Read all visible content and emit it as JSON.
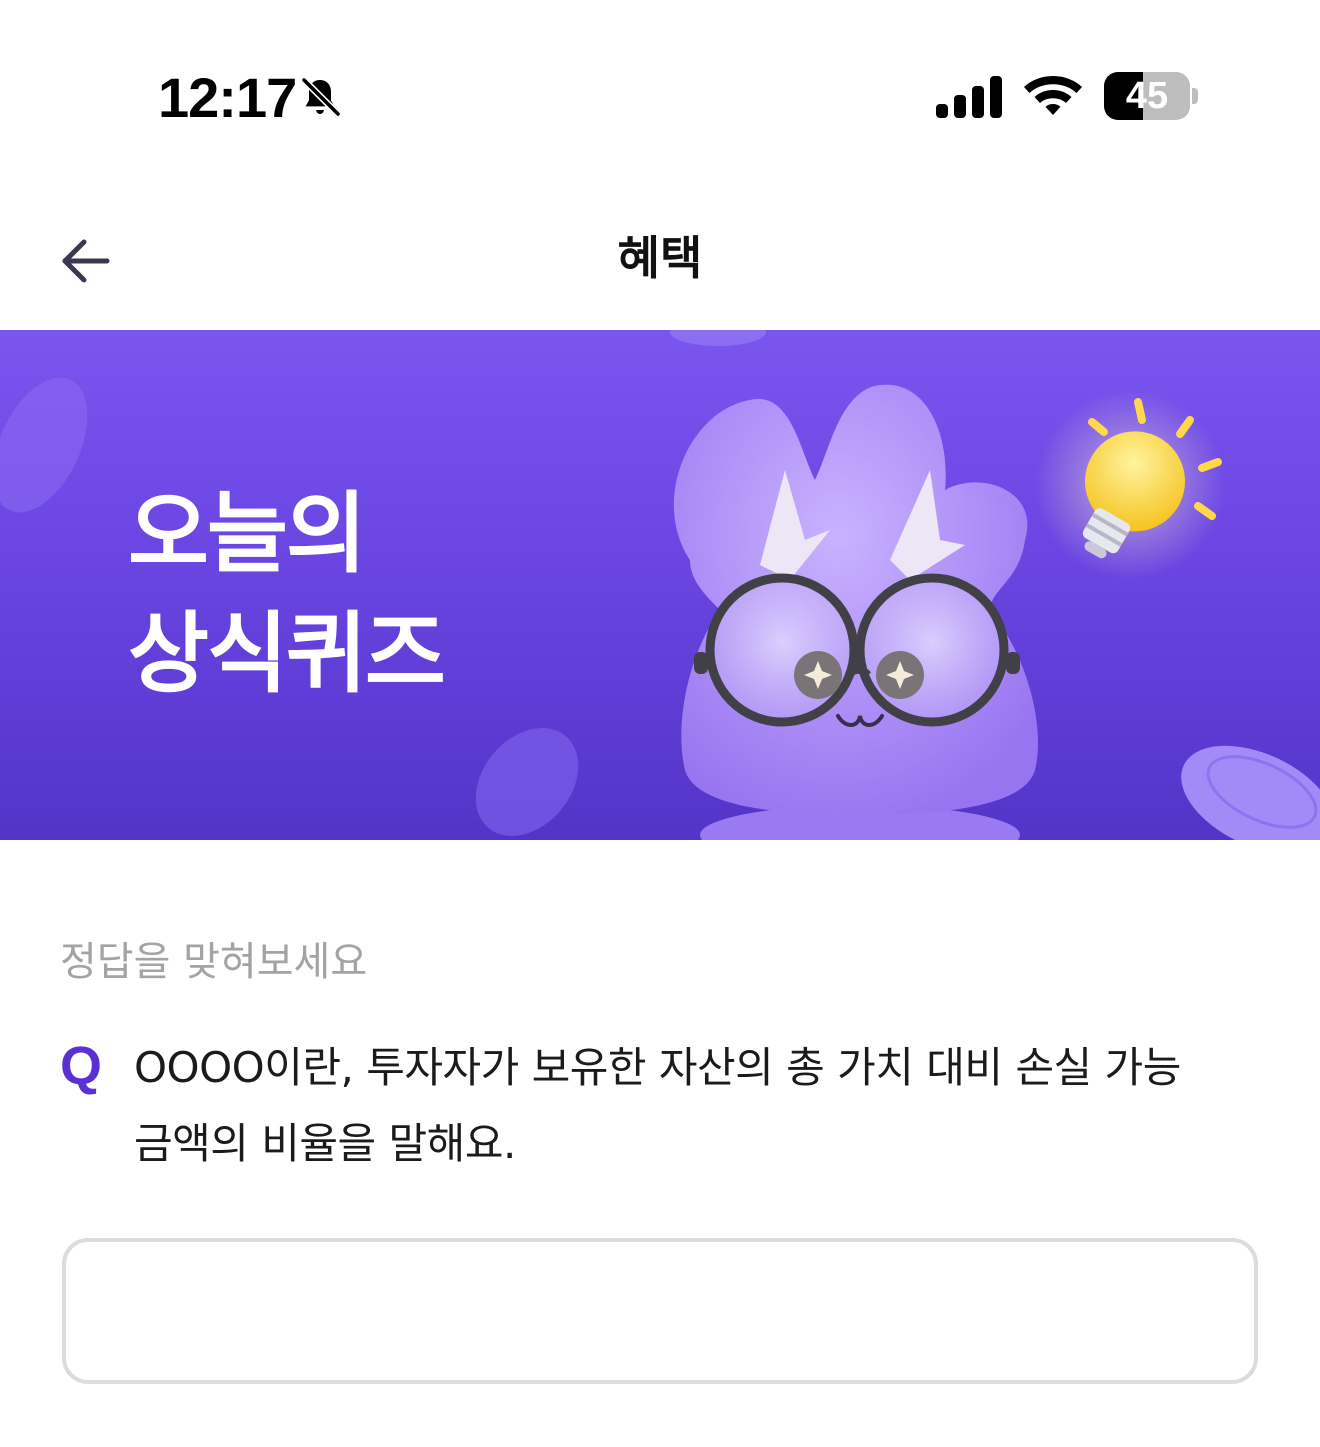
{
  "status_bar": {
    "time": "12:17",
    "battery_level": "45",
    "battery_fraction": 0.45,
    "icons": [
      "bell-slash-icon",
      "signal-icon",
      "wifi-icon",
      "battery-icon"
    ]
  },
  "header": {
    "title": "혜택",
    "back_icon": "arrow-left-icon"
  },
  "banner": {
    "title_line1": "오늘의",
    "title_line2": "상식퀴즈",
    "background_color": "#6a45e2"
  },
  "quiz": {
    "prompt": "정답을 맞혀보세요",
    "q_label": "Q",
    "question_line1": "OOOO이란, 투자자가 보유한 자산의 총 가치 대비 손실 가능",
    "question_line2": "금액의 비율을 말해요.",
    "answer_value": "",
    "accent_color": "#5b2fd6"
  }
}
